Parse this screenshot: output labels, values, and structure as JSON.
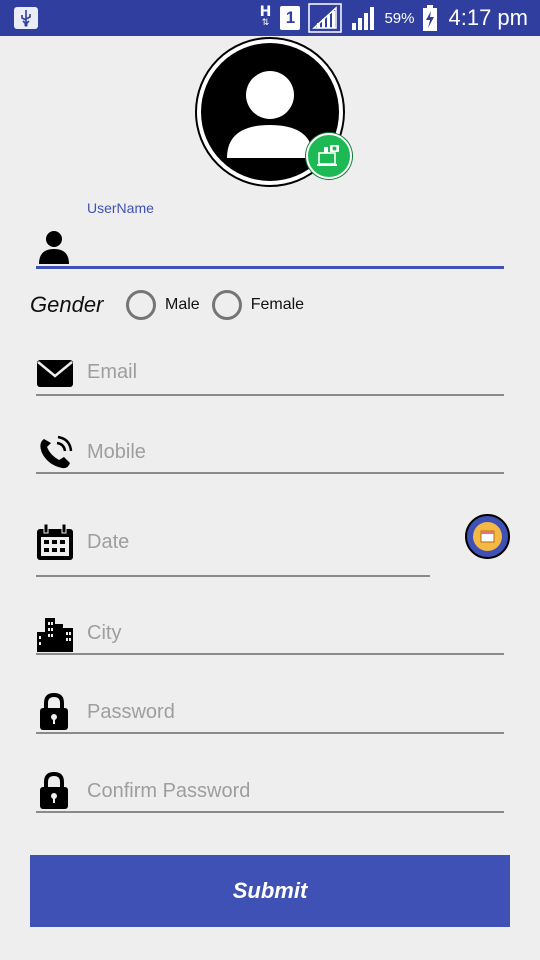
{
  "status_bar": {
    "network_type": "H",
    "sim_slot": "1",
    "battery_percent": "59%",
    "time": "4:17 pm"
  },
  "form": {
    "username_label": "UserName",
    "gender_label": "Gender",
    "gender_options": [
      "Male",
      "Female"
    ],
    "email_placeholder": "Email",
    "mobile_placeholder": "Mobile",
    "date_placeholder": "Date",
    "city_placeholder": "City",
    "password_placeholder": "Password",
    "confirm_password_placeholder": "Confirm Password",
    "submit_label": "Submit"
  },
  "colors": {
    "status_bar": "#303f9f",
    "accent": "#3f51b5",
    "camera_badge": "#1db954",
    "background": "#eeeeee"
  }
}
